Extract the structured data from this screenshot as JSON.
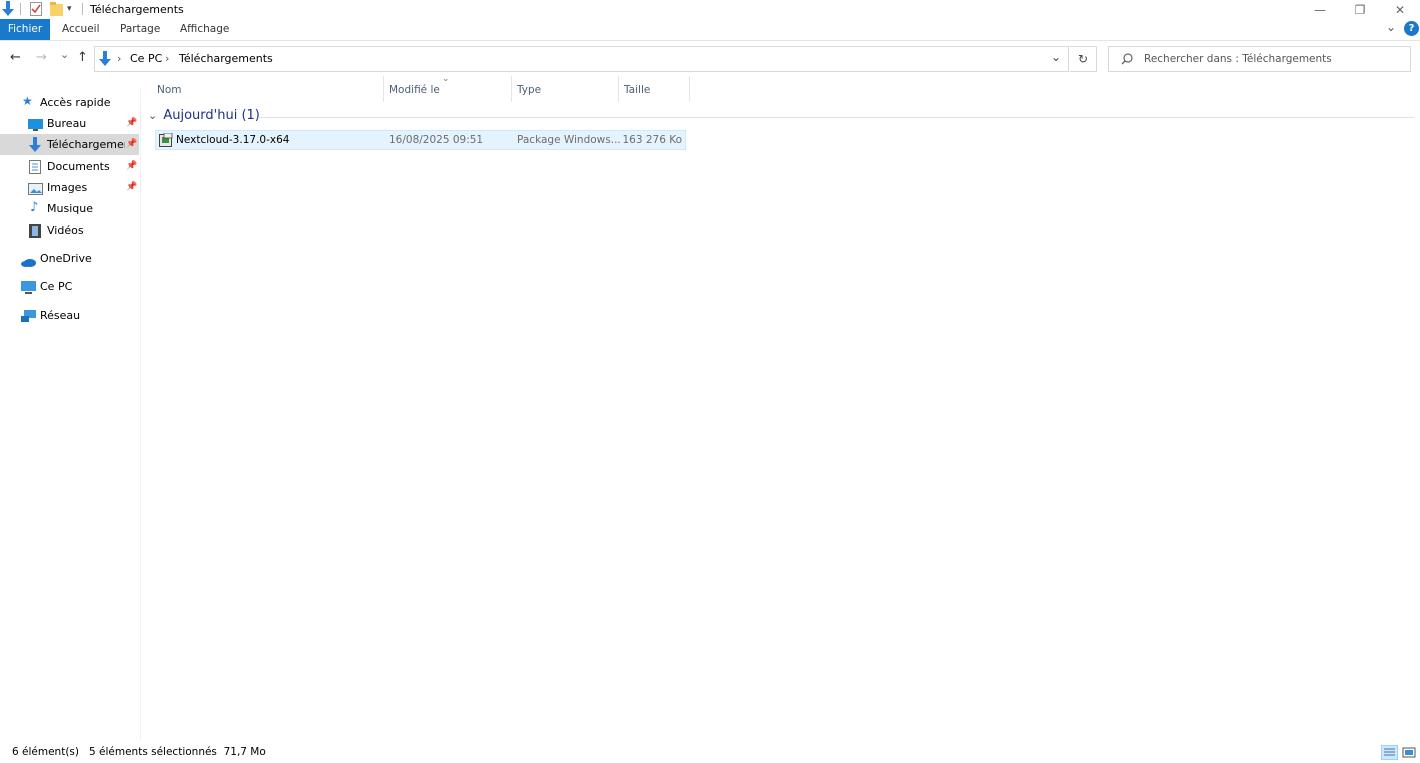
{
  "window": {
    "title": "Téléchargements",
    "minimize_glyph": "—",
    "restore_glyph": "❐",
    "close_glyph": "✕"
  },
  "quick_access_toolbar": {
    "icons": [
      "download-arrow-icon",
      "properties-icon",
      "new-folder-icon",
      "customize-dropdown-icon"
    ]
  },
  "ribbon": {
    "tabs": [
      "Fichier",
      "Accueil",
      "Partage",
      "Affichage"
    ],
    "expand_glyph": "⌄",
    "help_glyph": "?"
  },
  "address_bar": {
    "back_glyph": "←",
    "forward_glyph": "→",
    "recent_glyph": "⌄",
    "up_glyph": "↑",
    "breadcrumbs": [
      "Ce PC",
      "Téléchargements"
    ],
    "separator": "›",
    "dropdown_glyph": "⌄",
    "refresh_glyph": "↻"
  },
  "search": {
    "placeholder": "Rechercher dans : Téléchargements"
  },
  "sidebar": {
    "quick_access": "Accès rapide",
    "items": [
      {
        "label": "Bureau",
        "icon": "desktop-icon",
        "pinned": true
      },
      {
        "label": "Téléchargements",
        "icon": "downloads-icon",
        "pinned": true,
        "selected": true
      },
      {
        "label": "Documents",
        "icon": "documents-icon",
        "pinned": true
      },
      {
        "label": "Images",
        "icon": "pictures-icon",
        "pinned": true
      },
      {
        "label": "Musique",
        "icon": "music-icon",
        "pinned": false
      },
      {
        "label": "Vidéos",
        "icon": "videos-icon",
        "pinned": false
      }
    ],
    "onedrive": "OneDrive",
    "this_pc": "Ce PC",
    "network": "Réseau"
  },
  "columns": {
    "name": "Nom",
    "modified": "Modifié le",
    "type": "Type",
    "size": "Taille"
  },
  "groups": [
    {
      "label": "Aujourd'hui (1)",
      "files": [
        {
          "name": "Nextcloud-3.17.0-x64",
          "modified": "16/08/2025 09:51",
          "type": "Package Windows...",
          "size": "163 276 Ko"
        }
      ]
    }
  ],
  "status": {
    "count": "6 élément(s)",
    "selection": "5 éléments sélectionnés  71,7 Mo"
  },
  "colors": {
    "accent": "#1979ca",
    "selection_bg": "#e5f3ff",
    "group_header": "#1e3287"
  }
}
